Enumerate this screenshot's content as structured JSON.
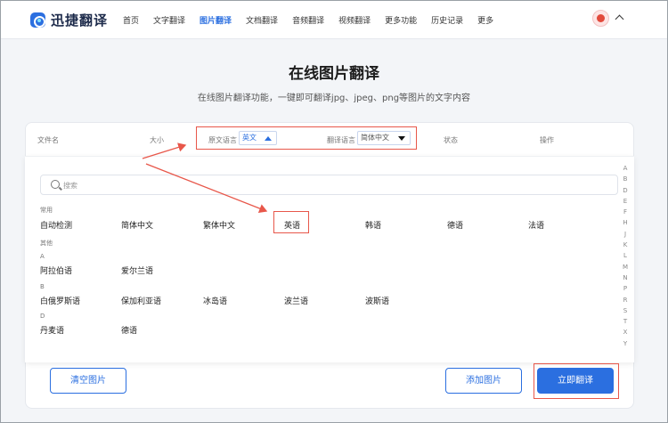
{
  "header": {
    "logo_text": "迅捷翻译",
    "nav": [
      "首页",
      "文字翻译",
      "图片翻译",
      "文档翻译",
      "音频翻译",
      "视频翻译",
      "更多功能",
      "历史记录",
      "更多"
    ],
    "active_nav": "图片翻译"
  },
  "hero": {
    "title": "在线图片翻译",
    "subtitle": "在线图片翻译功能，一键即可翻译jpg、jpeg、png等图片的文字内容"
  },
  "table_header": {
    "filename": "文件名",
    "size": "大小",
    "source_label": "原文语言",
    "source_value": "英文",
    "target_label": "翻译语言",
    "target_value": "简体中文",
    "status": "状态",
    "action": "操作"
  },
  "dropdown": {
    "search_placeholder": "搜索",
    "groups": [
      {
        "title": "常用",
        "items": [
          "自动检测",
          "简体中文",
          "繁体中文",
          "英语",
          "韩语",
          "德语",
          "法语"
        ]
      },
      {
        "title": "其他",
        "items": []
      },
      {
        "title": "A",
        "items": [
          "阿拉伯语",
          "爱尔兰语"
        ]
      },
      {
        "title": "B",
        "items": [
          "白俄罗斯语",
          "保加利亚语",
          "冰岛语",
          "波兰语",
          "波斯语"
        ]
      },
      {
        "title": "D",
        "items": [
          "丹麦语",
          "德语"
        ]
      }
    ],
    "alphabet": [
      "A",
      "B",
      "D",
      "E",
      "F",
      "H",
      "J",
      "K",
      "L",
      "M",
      "N",
      "P",
      "R",
      "S",
      "T",
      "X",
      "Y"
    ]
  },
  "buttons": {
    "clear": "清空图片",
    "add": "添加图片",
    "translate": "立即翻译"
  },
  "colors": {
    "accent": "#2b6fe0",
    "annotation": "#e8574a"
  }
}
